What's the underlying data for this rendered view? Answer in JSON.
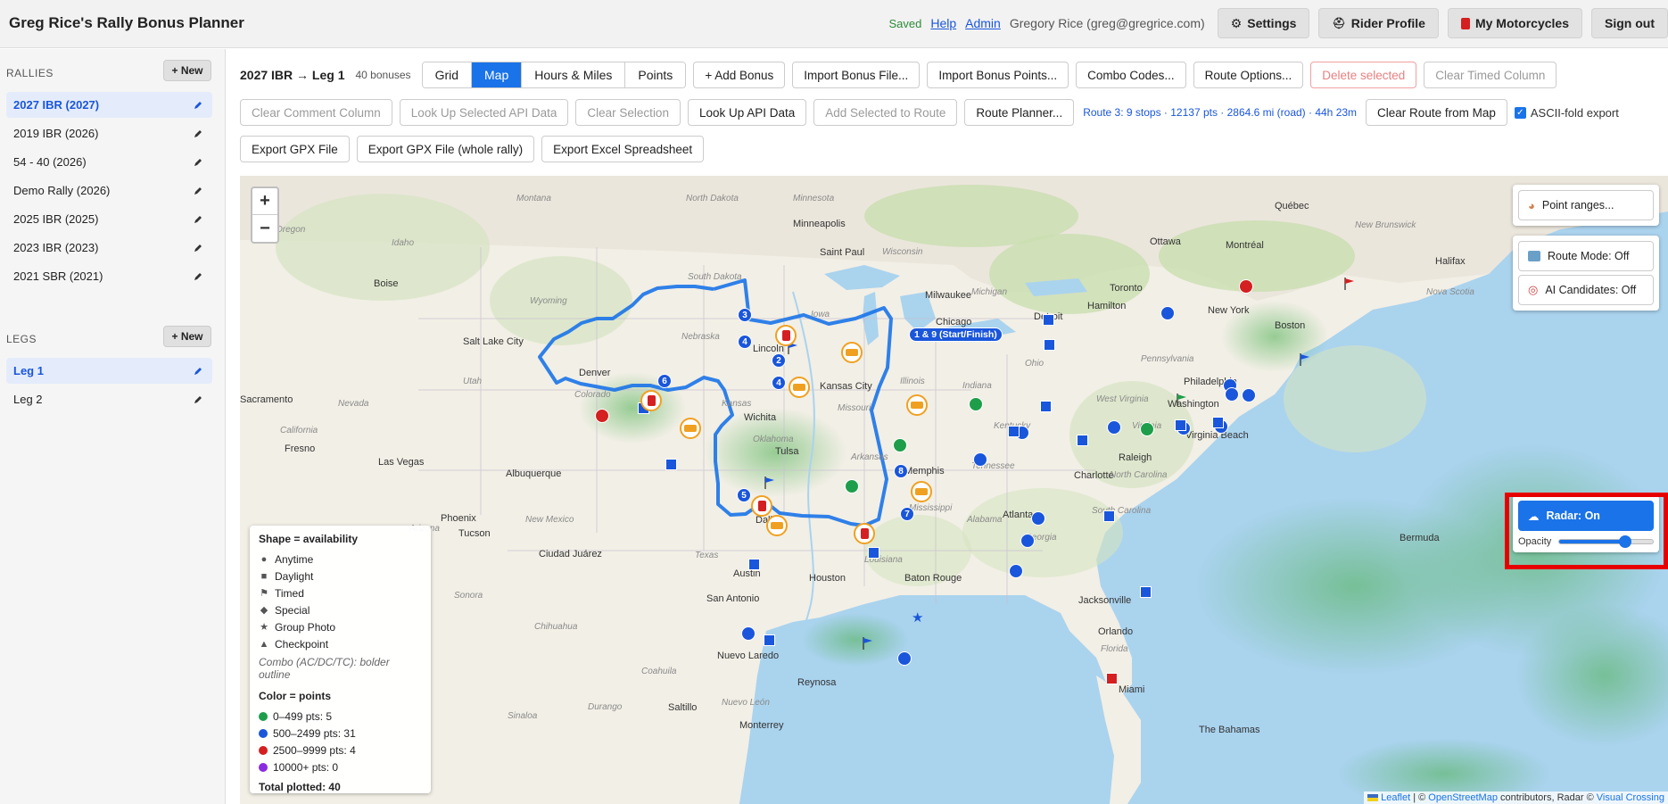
{
  "header": {
    "title": "Greg Rice's Rally Bonus Planner",
    "saved": "Saved",
    "help": "Help",
    "admin": "Admin",
    "user": "Gregory Rice (greg@gregrice.com)",
    "settings": "Settings",
    "rider_profile": "Rider Profile",
    "my_motorcycles": "My Motorcycles",
    "sign_out": "Sign out"
  },
  "sidebar": {
    "rallies_heading": "RALLIES",
    "new_label": "+ New",
    "rallies": [
      {
        "label": "2027 IBR (2027)",
        "active": true
      },
      {
        "label": "2019 IBR (2026)"
      },
      {
        "label": "54 - 40 (2026)"
      },
      {
        "label": "Demo Rally (2026)"
      },
      {
        "label": "2025 IBR (2025)"
      },
      {
        "label": "2023 IBR (2023)"
      },
      {
        "label": "2021 SBR (2021)"
      }
    ],
    "legs_heading": "LEGS",
    "legs": [
      {
        "label": "Leg 1",
        "active": true
      },
      {
        "label": "Leg 2"
      }
    ]
  },
  "toolbar": {
    "rally_leg": "2027 IBR → Leg 1",
    "bonus_count": "40 bonuses",
    "views": [
      "Grid",
      "Map",
      "Hours & Miles",
      "Points"
    ],
    "active_view": "Map",
    "add_bonus": "+ Add Bonus",
    "import_file": "Import Bonus File...",
    "import_points": "Import Bonus Points...",
    "combo_codes": "Combo Codes...",
    "route_options": "Route Options...",
    "delete_selected": "Delete selected",
    "clear_timed": "Clear Timed Column",
    "clear_comment": "Clear Comment Column",
    "lookup_selected": "Look Up Selected API Data",
    "clear_selection": "Clear Selection",
    "lookup_api": "Look Up API Data",
    "add_selected_route": "Add Selected to Route",
    "route_planner": "Route Planner...",
    "route_info": "Route 3: 9 stops · 12137 pts · 2864.6 mi (road) · 44h 23m",
    "clear_route": "Clear Route from Map",
    "ascii_fold": "ASCII-fold export",
    "export_gpx": "Export GPX File",
    "export_gpx_whole": "Export GPX File (whole rally)",
    "export_excel": "Export Excel Spreadsheet"
  },
  "map": {
    "zoom_in": "+",
    "zoom_out": "−",
    "start_finish": "1 & 9 (Start/Finish)",
    "controls": {
      "point_ranges": "Point ranges...",
      "route_mode": "Route Mode: Off",
      "ai_candidates": "AI Candidates: Off",
      "radar": "Radar: On",
      "opacity_label": "Opacity",
      "opacity_value": 0.7
    },
    "legend": {
      "shape_title": "Shape = availability",
      "shapes": [
        {
          "sym": "●",
          "label": "Anytime"
        },
        {
          "sym": "■",
          "label": "Daylight"
        },
        {
          "sym": "⚑",
          "label": "Timed"
        },
        {
          "sym": "◆",
          "label": "Special"
        },
        {
          "sym": "★",
          "label": "Group Photo"
        },
        {
          "sym": "▲",
          "label": "Checkpoint"
        }
      ],
      "combo_note": "Combo (AC/DC/TC): bolder outline",
      "color_title": "Color = points",
      "colors": [
        {
          "color": "#1e9e4a",
          "label": "0–499 pts: 5"
        },
        {
          "color": "#1a56db",
          "label": "500–2499 pts: 31"
        },
        {
          "color": "#d42020",
          "label": "2500–9999 pts: 4"
        },
        {
          "color": "#8a2be2",
          "label": "10000+ pts: 0"
        }
      ],
      "total": "Total plotted: 40"
    },
    "attribution": {
      "leaflet": "Leaflet",
      "osm": "OpenStreetMap",
      "middle": " contributors, Radar © ",
      "vc": "Visual Crossing"
    },
    "labels": {
      "cities": [
        "Québec",
        "Montréal",
        "Ottawa",
        "Halifax",
        "Boston",
        "New York",
        "Philadelphia",
        "Washington",
        "Hamilton",
        "Toronto",
        "Detroit",
        "Milwaukee",
        "Chicago",
        "Minneapolis",
        "Saint Paul",
        "Boise",
        "Salt Lake City",
        "Sacramento",
        "Fresno",
        "Las Vegas",
        "Denver",
        "Lincoln",
        "Kansas City",
        "Wichita",
        "Tulsa",
        "Memphis",
        "Atlanta",
        "Charlotte",
        "Raleigh",
        "Virginia Beach",
        "Albuquerque",
        "Phoenix",
        "Tucson",
        "Ciudad Juárez",
        "Dallas",
        "Austin",
        "Houston",
        "San Antonio",
        "Baton Rouge",
        "Jacksonville",
        "Orlando",
        "Miami",
        "Nuevo Laredo",
        "Reynosa",
        "Saltillo",
        "Monterrey",
        "The Bahamas",
        "Bermuda"
      ],
      "states": [
        "South Dakota",
        "Nebraska",
        "Kansas",
        "Colorado",
        "Wyoming",
        "Nevada",
        "California",
        "Arizona",
        "New Mexico",
        "Texas",
        "Oklahoma",
        "Missouri",
        "Iowa",
        "Illinois",
        "Indiana",
        "Ohio",
        "Kentucky",
        "Tennessee",
        "Mississippi",
        "Georgia",
        "South Carolina",
        "North Carolina",
        "Virginia",
        "West Virginia",
        "Pennsylvania",
        "Michigan",
        "Minnesota",
        "Alabama",
        "Arkansas",
        "Louisiana",
        "Florida",
        "Utah",
        "Idaho",
        "Oregon",
        "Montana",
        "North Dakota",
        "Wisconsin",
        "New Brunswick",
        "Nova Scotia",
        "Sonora",
        "Chihuahua",
        "Durango",
        "Coahuila",
        "Nuevo León",
        "Sinaloa"
      ]
    },
    "route_stops": [
      "1 & 9",
      "2",
      "3",
      "4",
      "5",
      "6",
      "7",
      "8"
    ]
  }
}
